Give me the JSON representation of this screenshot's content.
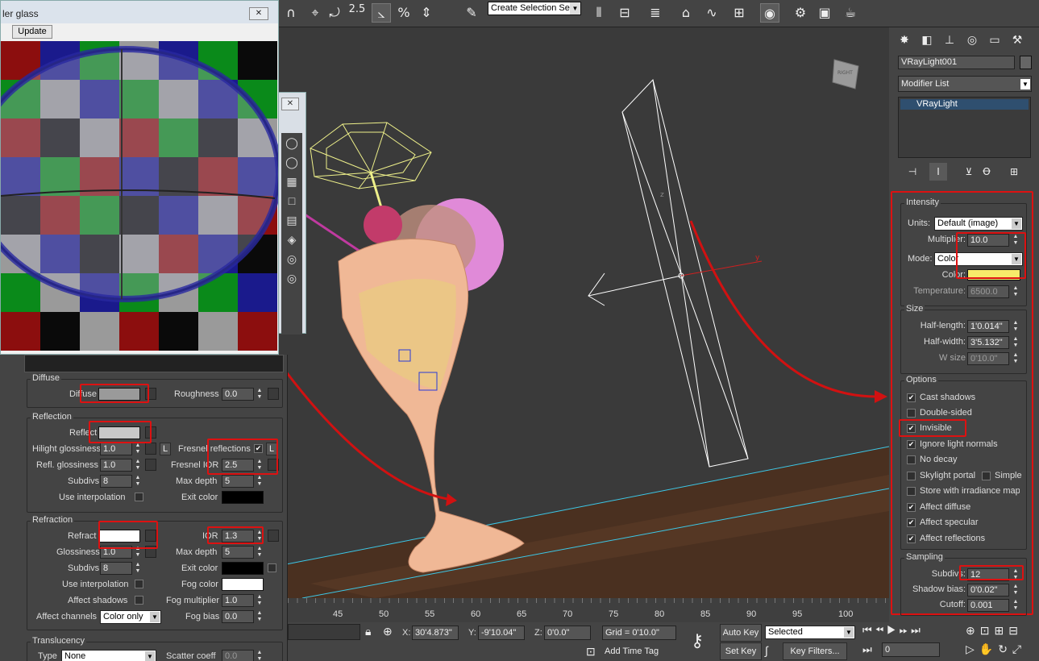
{
  "preview": {
    "title": "ler glass",
    "update": "Update"
  },
  "toolbar": {
    "snap_value": "2.5",
    "selection_set": "Create Selection Se"
  },
  "viewport": {
    "viewcube": "RIGHT",
    "light_axis_label": "y",
    "light_axis_z": "z"
  },
  "timeline": {
    "ticks": [
      "45",
      "50",
      "55",
      "60",
      "65",
      "70",
      "75",
      "80",
      "85",
      "90",
      "95",
      "100"
    ]
  },
  "status": {
    "x_label": "X:",
    "x_value": "30'4.873\"",
    "y_label": "Y:",
    "y_value": "-9'10.04\"",
    "z_label": "Z:",
    "z_value": "0'0.0\"",
    "grid": "Grid = 0'10.0\"",
    "add_time_tag": "Add Time Tag",
    "auto_key": "Auto Key",
    "set_key": "Set Key",
    "selected": "Selected",
    "key_filters": "Key Filters...",
    "frame": "0"
  },
  "command": {
    "object_name": "VRayLight001",
    "modifier_list": "Modifier List",
    "stack_item": "VRayLight",
    "intensity": {
      "title": "Intensity",
      "units_label": "Units:",
      "units_value": "Default (image)",
      "multiplier_label": "Multiplier:",
      "multiplier_value": "10.0",
      "mode_label": "Mode:",
      "mode_value": "Color",
      "color_label": "Color:",
      "color_hex": "#f7ec6a",
      "temperature_label": "Temperature:",
      "temperature_value": "6500.0"
    },
    "size": {
      "title": "Size",
      "half_length_label": "Half-length:",
      "half_length_value": "1'0.014\"",
      "half_width_label": "Half-width:",
      "half_width_value": "3'5.132\"",
      "w_size_label": "W size",
      "w_size_value": "0'10.0\""
    },
    "options": {
      "title": "Options",
      "cast_shadows": "Cast shadows",
      "double_sided": "Double-sided",
      "invisible": "Invisible",
      "ignore_light_normals": "Ignore light normals",
      "no_decay": "No decay",
      "skylight_portal": "Skylight portal",
      "simple": "Simple",
      "store_irradiance": "Store with irradiance map",
      "affect_diffuse": "Affect diffuse",
      "affect_specular": "Affect specular",
      "affect_reflections": "Affect reflections"
    },
    "sampling": {
      "title": "Sampling",
      "subdivs_label": "Subdivs:",
      "subdivs_value": "12",
      "shadow_bias_label": "Shadow bias:",
      "shadow_bias_value": "0'0.02\"",
      "cutoff_label": "Cutoff:",
      "cutoff_value": "0.001"
    }
  },
  "material": {
    "diffuse": {
      "title": "Diffuse",
      "diffuse_label": "Diffuse",
      "diffuse_color": "#9a9a9a",
      "roughness_label": "Roughness",
      "roughness_value": "0.0"
    },
    "reflection": {
      "title": "Reflection",
      "reflect_label": "Reflect",
      "reflect_color": "#c8c8c8",
      "hilight_label": "Hilight glossiness",
      "hilight_value": "1.0",
      "l_button": "L",
      "fresnel_label": "Fresnel reflections",
      "refl_gloss_label": "Refl. glossiness",
      "refl_gloss_value": "1.0",
      "fresnel_ior_label": "Fresnel IOR",
      "fresnel_ior_value": "2.5",
      "subdivs_label": "Subdivs",
      "subdivs_value": "8",
      "max_depth_label": "Max depth",
      "max_depth_value": "5",
      "use_interp_label": "Use interpolation",
      "exit_color_label": "Exit color"
    },
    "refraction": {
      "title": "Refraction",
      "refract_label": "Refract",
      "refract_color": "#ffffff",
      "ior_label": "IOR",
      "ior_value": "1.3",
      "gloss_label": "Glossiness",
      "gloss_value": "1.0",
      "max_depth_label": "Max depth",
      "max_depth_value": "5",
      "subdivs_label": "Subdivs",
      "subdivs_value": "8",
      "exit_color_label": "Exit color",
      "use_interp_label": "Use interpolation",
      "fog_color_label": "Fog color",
      "affect_shadows_label": "Affect shadows",
      "fog_mult_label": "Fog multiplier",
      "fog_mult_value": "1.0",
      "affect_channels_label": "Affect channels",
      "affect_channels_value": "Color only",
      "fog_bias_label": "Fog bias",
      "fog_bias_value": "0.0"
    },
    "translucency": {
      "title": "Translucency",
      "type_label": "Type",
      "type_value": "None",
      "scatter_label": "Scatter coeff",
      "scatter_value": "0.0"
    }
  },
  "colors": {
    "annotation_red": "#d11111",
    "wire_glass": "#f0b896",
    "wire_umbrella": "#eef08a",
    "cherry": "#c23b6a",
    "light_wire": "#ffffff"
  }
}
